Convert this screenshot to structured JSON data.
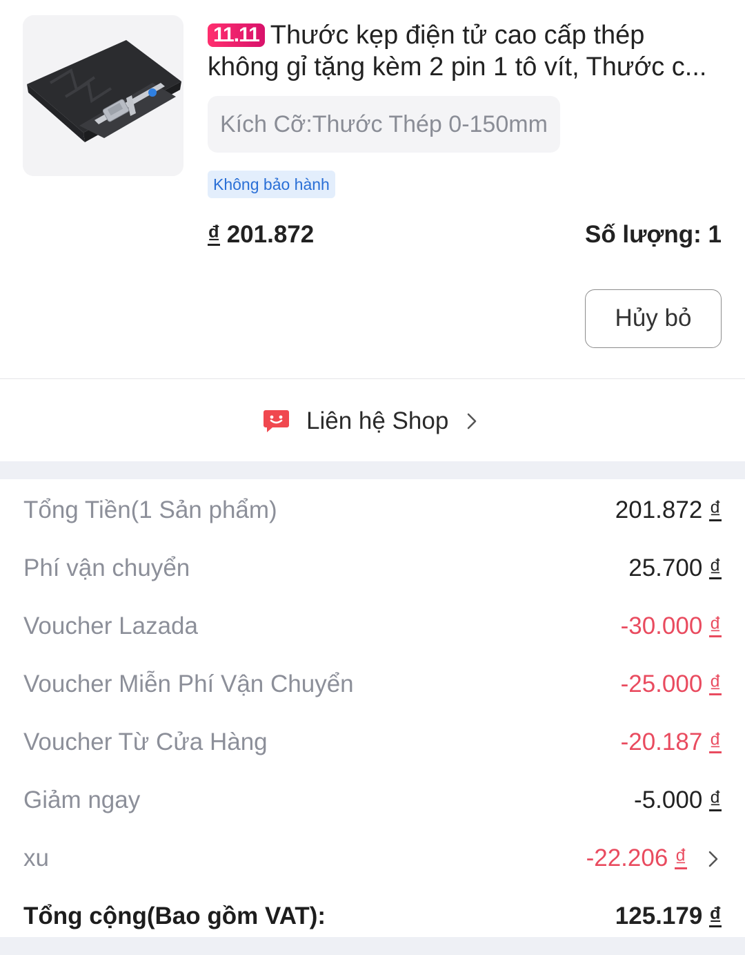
{
  "product": {
    "promo_badge": "11.11",
    "title_line1": "Thước kẹp điện tử cao cấp thép",
    "title_line2": "không gỉ tặng kèm 2 pin 1 tô vít, Thước c...",
    "variant": "Kích Cỡ:Thước Thép 0-150mm",
    "warranty": "Không bảo hành",
    "currency": "₫",
    "price": "201.872",
    "quantity": "Số lượng: 1",
    "cancel_label": "Hủy bỏ",
    "image_icon": "caliper-in-case-image"
  },
  "contact": {
    "label": "Liên hệ Shop",
    "icon": "chat-smile-icon",
    "accent": "#f0484f"
  },
  "summary": {
    "rows": [
      {
        "label": "Tổng Tiền(1 Sản phẩm)",
        "value": "201.872",
        "currency": "₫"
      },
      {
        "label": "Phí vận chuyển",
        "value": "25.700",
        "currency": "₫"
      },
      {
        "label": "Voucher Lazada",
        "value": "-30.000",
        "currency": "₫"
      },
      {
        "label": "Voucher Miễn Phí Vận Chuyển",
        "value": "-25.000",
        "currency": "₫"
      },
      {
        "label": "Voucher Từ Cửa Hàng",
        "value": "-20.187",
        "currency": "₫"
      },
      {
        "label": "Giảm ngay",
        "value": "-5.000",
        "currency": "₫"
      },
      {
        "label": "xu",
        "value": "-22.206",
        "currency": "₫"
      }
    ],
    "total": {
      "label": "Tổng cộng(Bao gồm VAT):",
      "value": "125.179",
      "currency": "₫"
    }
  },
  "colors": {
    "discount_red": "#e94b5f",
    "badge_blue": "#2a6fd6",
    "promo_pink": "#ff2f6e"
  }
}
